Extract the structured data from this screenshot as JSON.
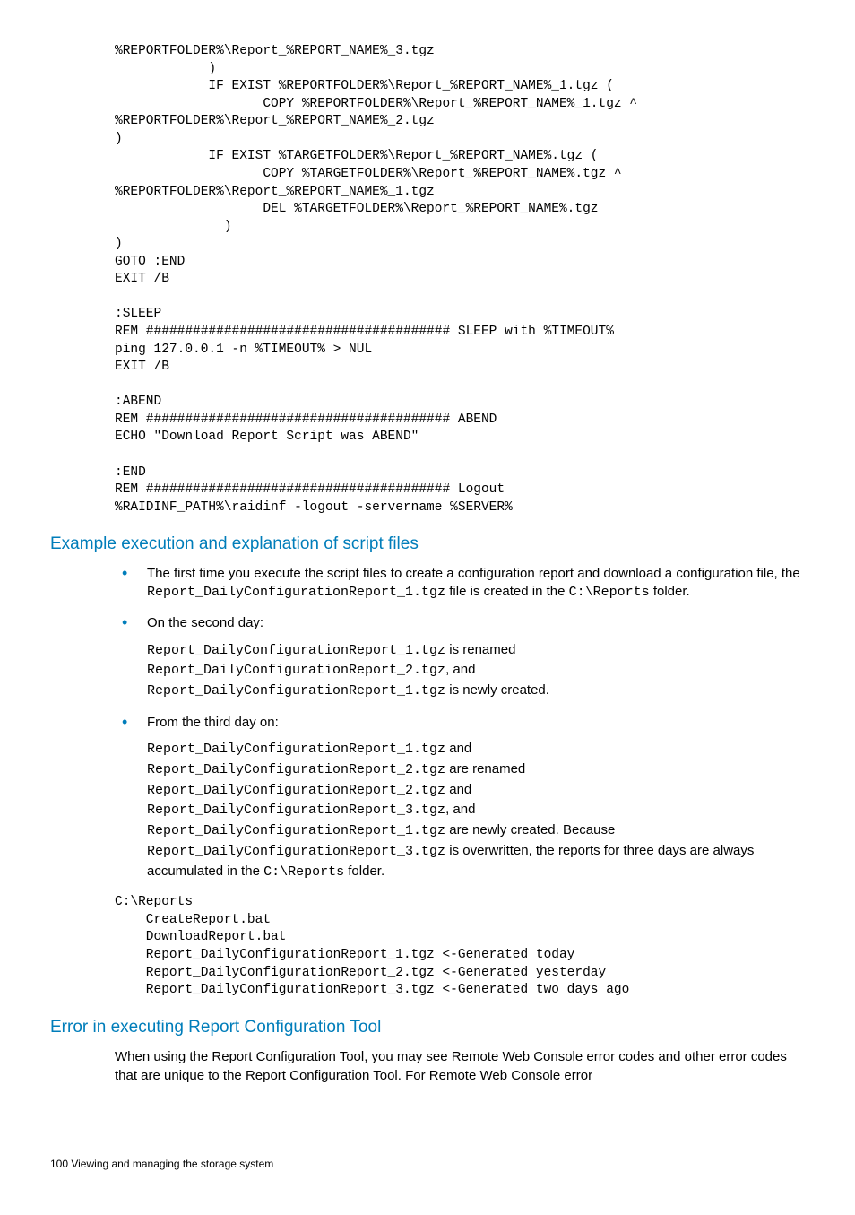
{
  "code_top": "%REPORTFOLDER%\\Report_%REPORT_NAME%_3.tgz\n            )\n            IF EXIST %REPORTFOLDER%\\Report_%REPORT_NAME%_1.tgz (\n                   COPY %REPORTFOLDER%\\Report_%REPORT_NAME%_1.tgz ^\n%REPORTFOLDER%\\Report_%REPORT_NAME%_2.tgz\n)\n            IF EXIST %TARGETFOLDER%\\Report_%REPORT_NAME%.tgz (\n                   COPY %TARGETFOLDER%\\Report_%REPORT_NAME%.tgz ^\n%REPORTFOLDER%\\Report_%REPORT_NAME%_1.tgz\n                   DEL %TARGETFOLDER%\\Report_%REPORT_NAME%.tgz\n              )\n)\nGOTO :END\nEXIT /B\n\n:SLEEP\nREM ####################################### SLEEP with %TIMEOUT%\nping 127.0.0.1 -n %TIMEOUT% > NUL\nEXIT /B\n\n:ABEND\nREM ####################################### ABEND\nECHO \"Download Report Script was ABEND\"\n\n:END\nREM ####################################### Logout\n%RAIDINF_PATH%\\raidinf -logout -servername %SERVER%",
  "heading_example": "Example execution and explanation of script files",
  "bullet1": {
    "pre": "The first time you execute the script files to create a configuration report and download a configuration file, the ",
    "mono1": "Report_DailyConfigurationReport_1.tgz",
    "mid": " file is created in the ",
    "mono2": "C:\\Reports",
    "post": " folder."
  },
  "bullet2": {
    "lead": "On the second day:",
    "l1a": "Report_DailyConfigurationReport_1.tgz",
    "l1b": " is renamed",
    "l2a": "Report_DailyConfigurationReport_2.tgz",
    "l2b": ", and",
    "l3a": "Report_DailyConfigurationReport_1.tgz",
    "l3b": " is newly created."
  },
  "bullet3": {
    "lead": "From the third day on:",
    "l1a": "Report_DailyConfigurationReport_1.tgz",
    "l1b": " and",
    "l2a": "Report_DailyConfigurationReport_2.tgz",
    "l2b": " are renamed",
    "l3a": "Report_DailyConfigurationReport_2.tgz",
    "l3b": " and",
    "l4a": "Report_DailyConfigurationReport_3.tgz",
    "l4b": ", and",
    "l5a": "Report_DailyConfigurationReport_1.tgz",
    "l5b": " are newly created. Because",
    "l6a": "Report_DailyConfigurationReport_3.tgz",
    "l6b": " is overwritten, the reports for three days are always accumulated in the ",
    "l6c": "C:\\Reports",
    "l6d": " folder."
  },
  "code_reports": "C:\\Reports\n    CreateReport.bat\n    DownloadReport.bat\n    Report_DailyConfigurationReport_1.tgz <-Generated today\n    Report_DailyConfigurationReport_2.tgz <-Generated yesterday\n    Report_DailyConfigurationReport_3.tgz <-Generated two days ago",
  "heading_error": "Error in executing Report Configuration Tool",
  "error_para": "When using the Report Configuration Tool, you may see Remote Web Console error codes and other error codes that are unique to the Report Configuration Tool. For Remote Web Console error",
  "footer": "100   Viewing and managing the storage system"
}
